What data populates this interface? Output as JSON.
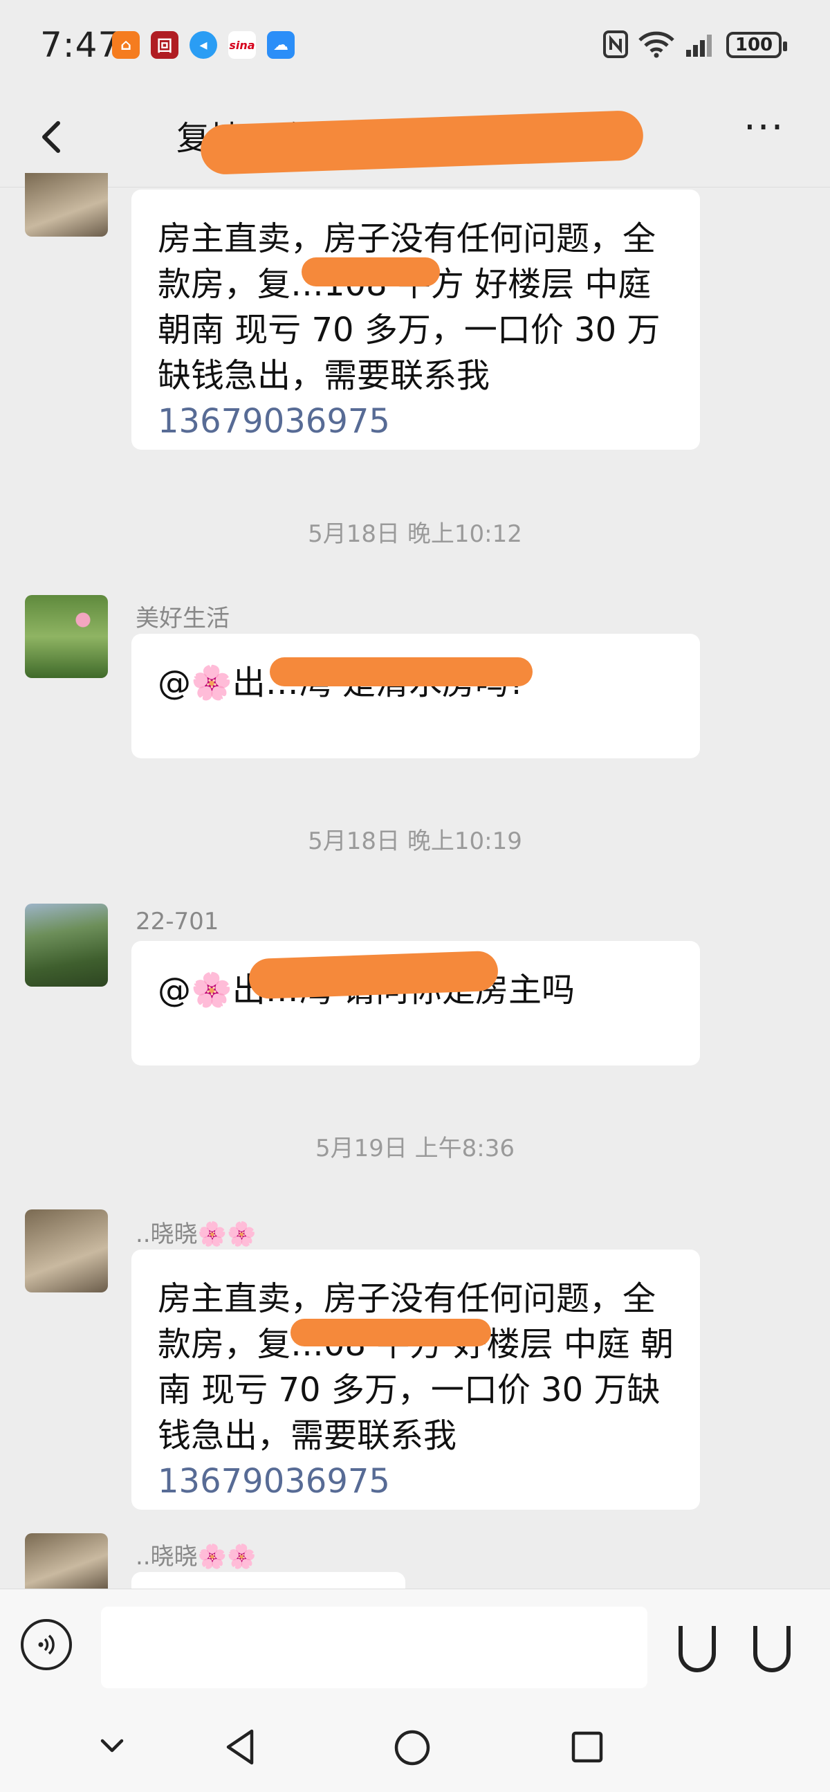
{
  "status_bar": {
    "time": "7:47",
    "battery": "100",
    "app_icons": [
      "orange-app-icon",
      "red-bank-icon",
      "blue-app-icon",
      "sina-icon",
      "weather-icon"
    ],
    "app_icon_labels": [
      "",
      "",
      "",
      "sina",
      ""
    ]
  },
  "header": {
    "title": "复地…附湾…群(1…)",
    "back_icon": "chevron-left-icon",
    "more_icon": "ellipsis-icon"
  },
  "messages": [
    {
      "sender": "",
      "text": "房主直卖，房子没有任何问题，全款房，复…108 平方  好楼层 中庭 朝南   现亏 70 多万，一口价 30 万缺钱急出，需要联系我",
      "phone": "13679036975"
    },
    {
      "timestamp": "5月18日 晚上10:12"
    },
    {
      "sender": "美好生活",
      "text": "@🌸出…湾  是清水房吗?"
    },
    {
      "timestamp": "5月18日 晚上10:19"
    },
    {
      "sender": "22-701",
      "text": "@🌸出…湾  请问你是房主吗"
    },
    {
      "timestamp": "5月19日 上午8:36"
    },
    {
      "sender": "..晓晓🌸🌸",
      "text": "房主直卖，房子没有任何问题，全款房，复…08 平方  好楼层 中庭 朝南   现亏 70 多万，一口价 30 万缺钱急出，需要联系我",
      "phone": "13679036975"
    },
    {
      "sender": "..晓晓🌸🌸"
    }
  ],
  "input": {
    "placeholder": "",
    "voice_icon": "voice-icon"
  },
  "nav": [
    "collapse-icon",
    "back-triangle-icon",
    "home-circle-icon",
    "recents-square-icon"
  ]
}
